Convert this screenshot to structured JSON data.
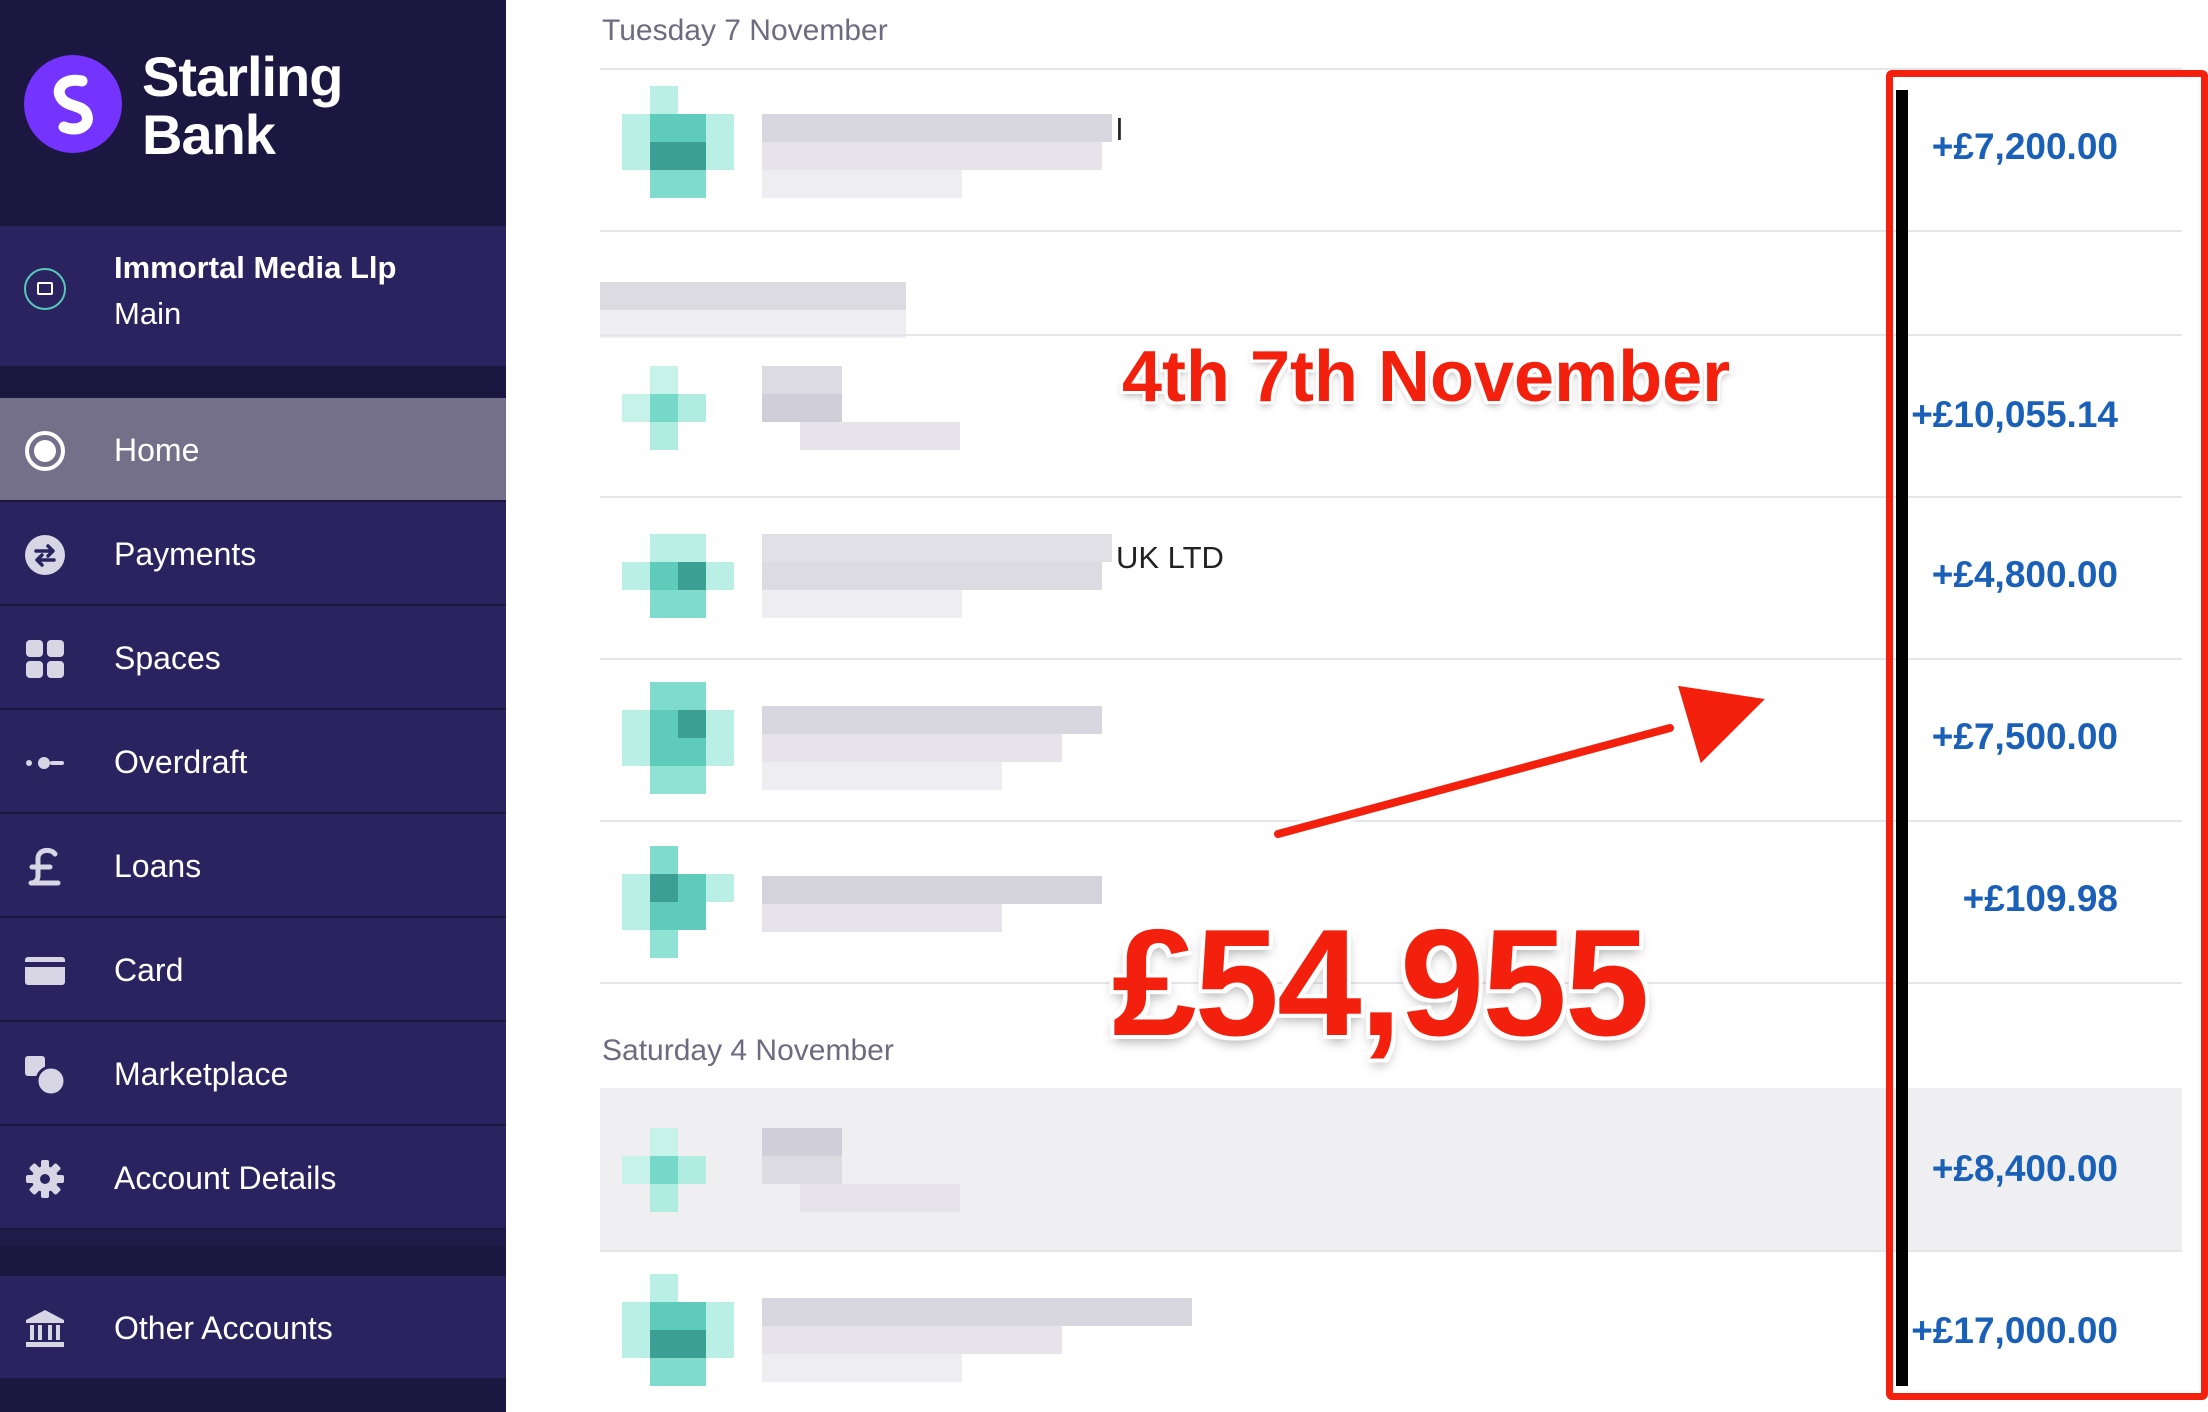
{
  "brand": {
    "name_line1": "Starling",
    "name_line2": "Bank"
  },
  "account": {
    "name": "Immortal Media Llp",
    "sub": "Main"
  },
  "nav": [
    {
      "label": "Home",
      "icon": "home-icon",
      "active": true
    },
    {
      "label": "Payments",
      "icon": "payments-icon",
      "active": false
    },
    {
      "label": "Spaces",
      "icon": "spaces-icon",
      "active": false
    },
    {
      "label": "Overdraft",
      "icon": "overdraft-icon",
      "active": false
    },
    {
      "label": "Loans",
      "icon": "pound-icon",
      "active": false
    },
    {
      "label": "Card",
      "icon": "card-icon",
      "active": false
    },
    {
      "label": "Marketplace",
      "icon": "marketplace-icon",
      "active": false
    },
    {
      "label": "Account Details",
      "icon": "gear-icon",
      "active": false
    }
  ],
  "other_accounts": {
    "label": "Other Accounts",
    "icon": "bank-icon"
  },
  "groups": [
    {
      "date": "Tuesday 7 November"
    },
    {
      "date": "Saturday 4 November"
    }
  ],
  "transactions": [
    {
      "name_fragment": "l",
      "amount": "+£7,200.00"
    },
    {
      "name_fragment": "",
      "amount": ""
    },
    {
      "name_fragment": "",
      "amount": "+£10,055.14"
    },
    {
      "name_fragment": "UK LTD",
      "amount": "+£4,800.00"
    },
    {
      "name_fragment": "",
      "amount": "+£7,500.00"
    },
    {
      "name_fragment": "",
      "amount": "+£109.98"
    },
    {
      "name_fragment": "",
      "amount": "+£8,400.00"
    },
    {
      "name_fragment": "",
      "amount": "+£17,000.00"
    }
  ],
  "annotations": {
    "dates": "4th 7th November",
    "total": "£54,955"
  },
  "colors": {
    "sidebar": "#1f1a48",
    "sidebar_item": "#2a2360",
    "active_item": "#757089",
    "brand_purple": "#7433ff",
    "amount_blue": "#1a60b8",
    "annotation_red": "#f2200c",
    "teal": "#58c9b9"
  }
}
